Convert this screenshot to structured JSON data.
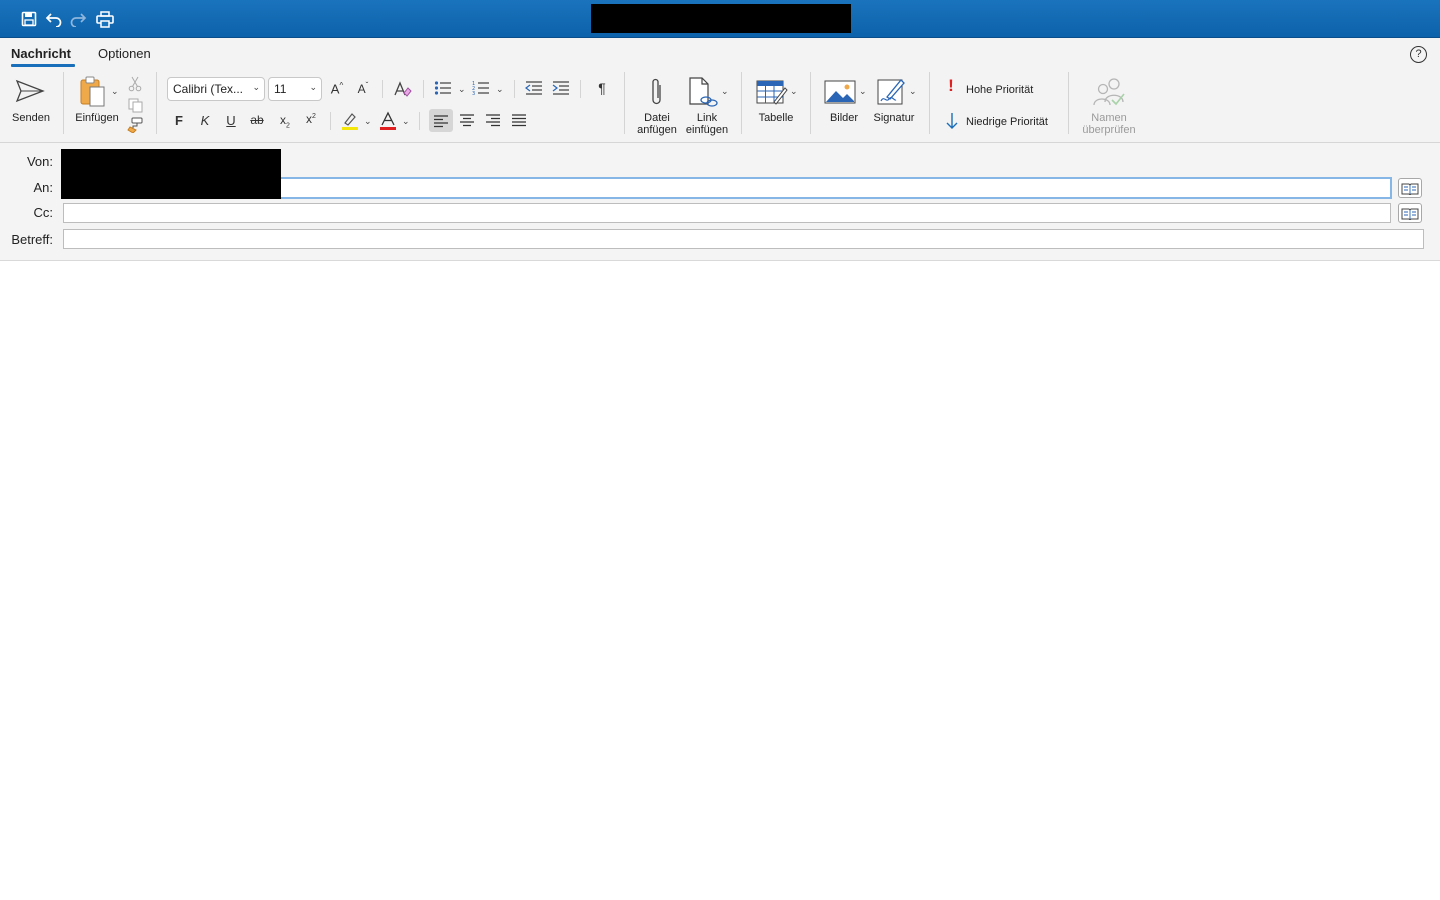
{
  "window": {
    "title": ""
  },
  "tabs": [
    {
      "label": "Nachricht",
      "active": true
    },
    {
      "label": "Optionen",
      "active": false
    }
  ],
  "ribbon": {
    "send_label": "Senden",
    "paste_label": "Einfügen",
    "font_name": "Calibri (Tex...",
    "font_size": "11",
    "bold": "F",
    "italic": "K",
    "underline": "U",
    "strike": "ab",
    "attach_label_1": "Datei",
    "attach_label_2": "anfügen",
    "link_label_1": "Link",
    "link_label_2": "einfügen",
    "table_label": "Tabelle",
    "images_label": "Bilder",
    "signature_label": "Signatur",
    "high_priority_label": "Hohe Priorität",
    "low_priority_label": "Niedrige Priorität",
    "check_names_label_1": "Namen",
    "check_names_label_2": "überprüfen"
  },
  "fields": {
    "from_label": "Von:",
    "to_label": "An:",
    "cc_label": "Cc:",
    "subject_label": "Betreff:",
    "to_value": "",
    "cc_value": "",
    "subject_value": ""
  },
  "colors": {
    "titlebar": "#0d63ab",
    "accent": "#1a6fba",
    "highlight": "#f5e60a",
    "font_color": "#e02020",
    "priority_high": "#e02020",
    "priority_low": "#1a6fba"
  }
}
